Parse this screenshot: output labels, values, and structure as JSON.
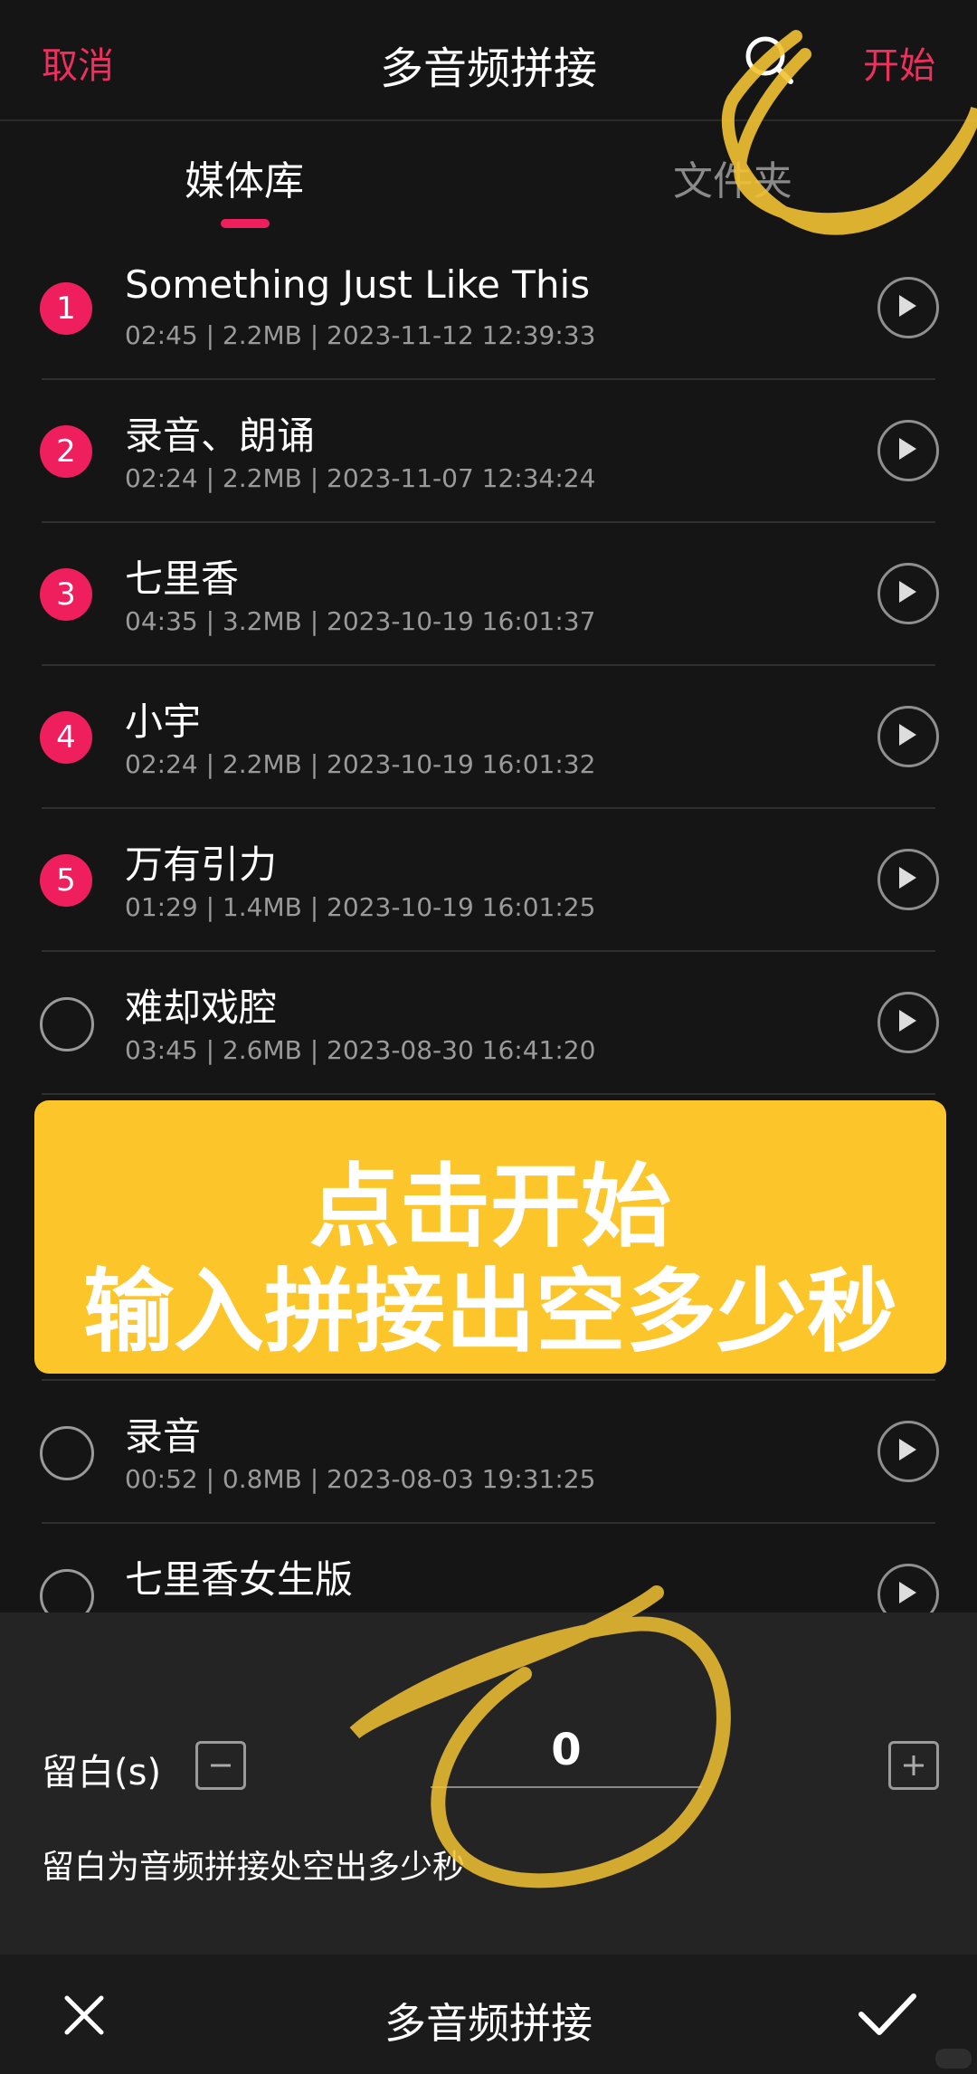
{
  "header": {
    "cancel_label": "取消",
    "title": "多音频拼接",
    "start_label": "开始"
  },
  "tabs": [
    {
      "label": "媒体库",
      "active": true
    },
    {
      "label": "文件夹",
      "active": false
    }
  ],
  "files": [
    {
      "index": "1",
      "selected": true,
      "name": "Something Just Like This",
      "meta": "02:45 | 2.2MB | 2023-11-12 12:39:33"
    },
    {
      "index": "2",
      "selected": true,
      "name": "录音、朗诵",
      "meta": "02:24 | 2.2MB | 2023-11-07 12:34:24"
    },
    {
      "index": "3",
      "selected": true,
      "name": "七里香",
      "meta": "04:35 | 3.2MB | 2023-10-19 16:01:37"
    },
    {
      "index": "4",
      "selected": true,
      "name": "小宇",
      "meta": "02:24 | 2.2MB | 2023-10-19 16:01:32"
    },
    {
      "index": "5",
      "selected": true,
      "name": "万有引力",
      "meta": "01:29 | 1.4MB | 2023-10-19 16:01:25"
    },
    {
      "index": "",
      "selected": false,
      "name": "难却戏腔",
      "meta": "03:45 | 2.6MB | 2023-08-30 16:41:20"
    },
    {
      "index": "",
      "selected": false,
      "name": "录音",
      "meta": "00:52 | 0.8MB | 2023-08-03 19:31:25"
    },
    {
      "index": "",
      "selected": false,
      "name": "七里香女生版",
      "meta": ""
    }
  ],
  "banner": {
    "line1": "点击开始",
    "line2": "输入拼接出空多少秒",
    "color": "#fcc62a"
  },
  "margin_panel": {
    "label": "留白(s)",
    "value": "0",
    "hint": "留白为音频拼接处空出多少秒"
  },
  "bottom_bar": {
    "title": "多音频拼接"
  },
  "colors": {
    "accent": "#ef1f5e",
    "background": "#151515",
    "annotation": "#f1c232"
  }
}
